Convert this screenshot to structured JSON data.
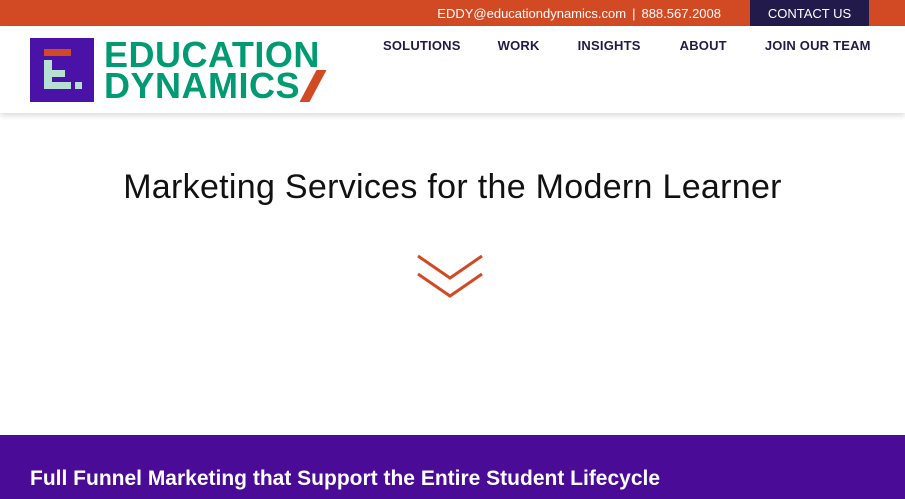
{
  "topbar": {
    "email": "EDDY@educationdynamics.com",
    "separator": "|",
    "phone": "888.567.2008",
    "contact_button": "CONTACT US"
  },
  "logo": {
    "line1": "EDUCATION",
    "line2": "DYNAMICS"
  },
  "nav": {
    "items": [
      {
        "label": "SOLUTIONS"
      },
      {
        "label": "WORK"
      },
      {
        "label": "INSIGHTS"
      },
      {
        "label": "ABOUT"
      },
      {
        "label": "JOIN OUR TEAM"
      }
    ]
  },
  "hero": {
    "title": "Marketing Services for the Modern Learner",
    "scroll_icon": "double-chevron-down-icon"
  },
  "band": {
    "heading": "Full Funnel Marketing that Support the Entire Student Lifecycle"
  },
  "colors": {
    "brand_orange": "#d24a24",
    "brand_navy": "#221a4a",
    "brand_green": "#009b72",
    "brand_purple": "#4a0b96",
    "logo_mark_purple": "#4b12a8",
    "logo_mark_mint": "#b7e0d4"
  }
}
